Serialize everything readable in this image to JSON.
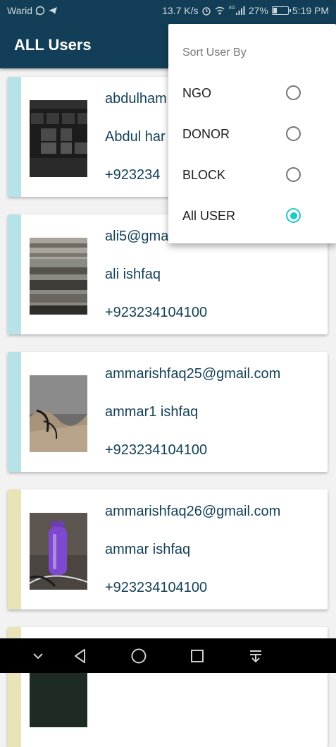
{
  "status_bar": {
    "carrier": "Warid",
    "speed": "13.7 K/s",
    "network": "4G",
    "battery": "27%",
    "battery_level": 0.27,
    "time": "5:19 PM"
  },
  "app_bar": {
    "title": "ALL Users"
  },
  "users": [
    {
      "email": "abdulham",
      "name": "Abdul har",
      "phone": "+923234",
      "stripe_color": "#b6e2e8"
    },
    {
      "email": "ali5@gma",
      "name": "ali ishfaq",
      "phone": "+923234104100",
      "stripe_color": "#b6e2e8"
    },
    {
      "email": "ammarishfaq25@gmail.com",
      "name": "ammar1 ishfaq",
      "phone": "+923234104100",
      "stripe_color": "#b6e2e8"
    },
    {
      "email": "ammarishfaq26@gmail.com",
      "name": "ammar ishfaq",
      "phone": "+923234104100",
      "stripe_color": "#e8e4b8"
    },
    {
      "email": "",
      "name": "",
      "phone": "",
      "stripe_color": "#e8e4b8"
    }
  ],
  "sort_menu": {
    "title": "Sort User By",
    "options": [
      {
        "label": "NGO",
        "selected": false
      },
      {
        "label": "DONOR",
        "selected": false
      },
      {
        "label": "BLOCK",
        "selected": false
      },
      {
        "label": "All USER",
        "selected": true
      }
    ]
  },
  "nav_bar": {
    "icons": [
      "chevron-down-icon",
      "back-icon",
      "home-icon",
      "recents-icon",
      "notification-pulldown-icon"
    ]
  },
  "colors": {
    "primary": "#123f57",
    "accent": "#1ec9c0"
  }
}
